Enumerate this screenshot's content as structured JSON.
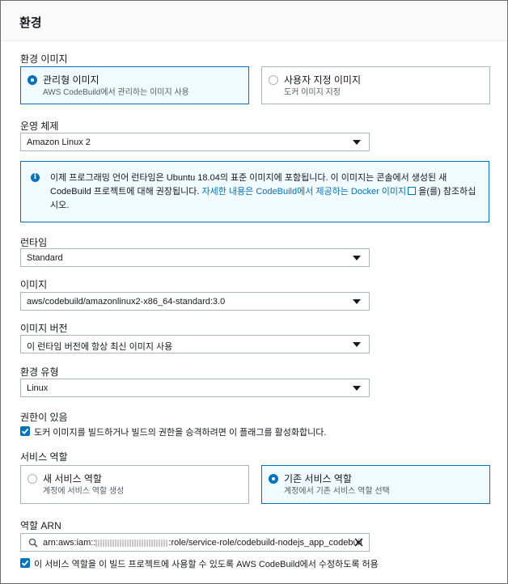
{
  "section": {
    "title": "환경"
  },
  "environment_image": {
    "label": "환경 이미지",
    "options": [
      {
        "title": "관리형 이미지",
        "desc": "AWS CodeBuild에서 관리하는 이미지 사용",
        "selected": true
      },
      {
        "title": "사용자 지정 이미지",
        "desc": "도커 이미지 지정",
        "selected": false
      }
    ]
  },
  "os": {
    "label": "운영 체제",
    "value": "Amazon Linux 2"
  },
  "info": {
    "text_before": "이제 프로그래밍 언어 런타임은 Ubuntu 18.04의 표준 이미지에 포함됩니다. 이 이미지는 콘솔에서 생성된 새 CodeBuild 프로젝트에 대해 권장됩니다. ",
    "link": "자세한 내용은 CodeBuild에서 제공하는 Docker 이미지",
    "text_after": "을(를) 참조하십시오."
  },
  "runtime": {
    "label": "런타임",
    "value": "Standard"
  },
  "image": {
    "label": "이미지",
    "value": "aws/codebuild/amazonlinux2-x86_64-standard:3.0"
  },
  "image_version": {
    "label": "이미지 버전",
    "value": "이 런타임 버전에 항상 최신 이미지 사용"
  },
  "env_type": {
    "label": "환경 유형",
    "value": "Linux"
  },
  "privileged": {
    "label": "권한이 있음",
    "checkbox_text": "도커 이미지를 빌드하거나 빌드의 권한을 승격하려면 이 플래그를 활성화합니다.",
    "checked": true
  },
  "service_role": {
    "label": "서비스 역할",
    "options": [
      {
        "title": "새 서비스 역할",
        "desc": "계정에 서비스 역할 생성",
        "selected": false
      },
      {
        "title": "기존 서비스 역할",
        "desc": "계정에서 기존 서비스 역할 선택",
        "selected": true
      }
    ]
  },
  "role_arn": {
    "label": "역할 ARN",
    "prefix": "arn:aws:iam::",
    "suffix": ":role/service-role/codebuild-nodejs_app_codebuil"
  },
  "allow_edit": {
    "checkbox_text": "이 서비스 역할을 이 빌드 프로젝트에 사용할 수 있도록 AWS CodeBuild에서 수정하도록 허용",
    "checked": true
  },
  "colors": {
    "accent": "#0073bb",
    "border": "#aab7b8",
    "info_bg": "#f1faff"
  }
}
